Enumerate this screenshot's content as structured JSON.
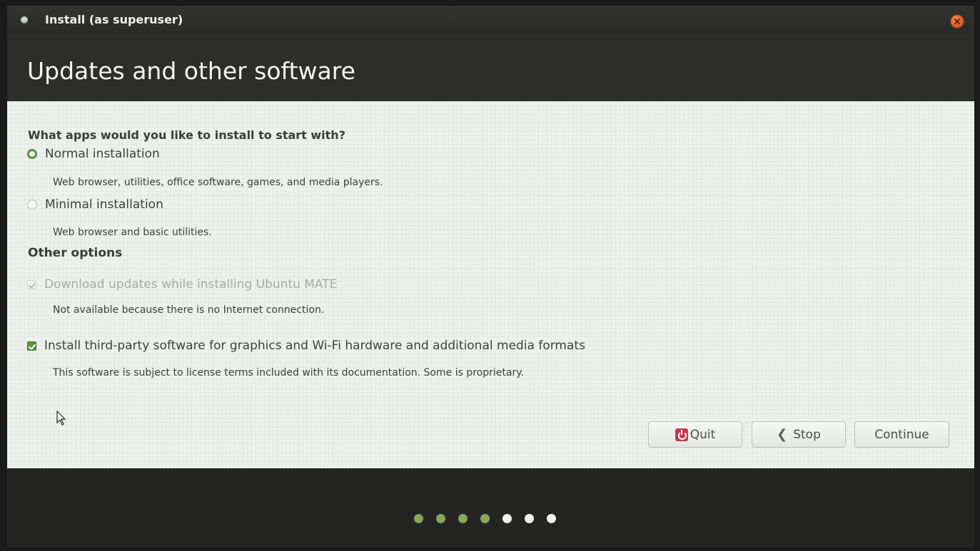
{
  "window": {
    "title": "Install (as superuser)",
    "heading": "Updates and other software"
  },
  "install_type": {
    "question": "What apps would you like to install to start with?",
    "options": [
      {
        "label": "Normal installation",
        "description": "Web browser, utilities, office software, games, and media players.",
        "selected": true
      },
      {
        "label": "Minimal installation",
        "description": "Web browser and basic utilities.",
        "selected": false
      }
    ]
  },
  "other_options": {
    "title": "Other options",
    "download_updates": {
      "label": "Download updates while installing Ubuntu MATE",
      "description": "Not available because there is no Internet connection.",
      "checked": true,
      "enabled": false
    },
    "third_party": {
      "label": "Install third-party software for graphics and Wi-Fi hardware and additional media formats",
      "description": "This software is subject to license terms included with its documentation. Some is proprietary.",
      "checked": true,
      "enabled": true
    }
  },
  "buttons": {
    "quit": "Quit",
    "stop": "Stop",
    "continue": "Continue"
  },
  "progress": {
    "completed_steps": 4,
    "total_steps": 7
  },
  "icons": {
    "app": "ubuntu-mate-icon",
    "close": "close-icon",
    "quit": "power-icon",
    "stop": "chevron-left-icon"
  },
  "colors": {
    "accent": "#5d8f3a",
    "progress_done": "#87a65a",
    "progress_todo": "#f2f4f2",
    "quit_icon": "#c43a52",
    "close_button": "#d9542a"
  }
}
